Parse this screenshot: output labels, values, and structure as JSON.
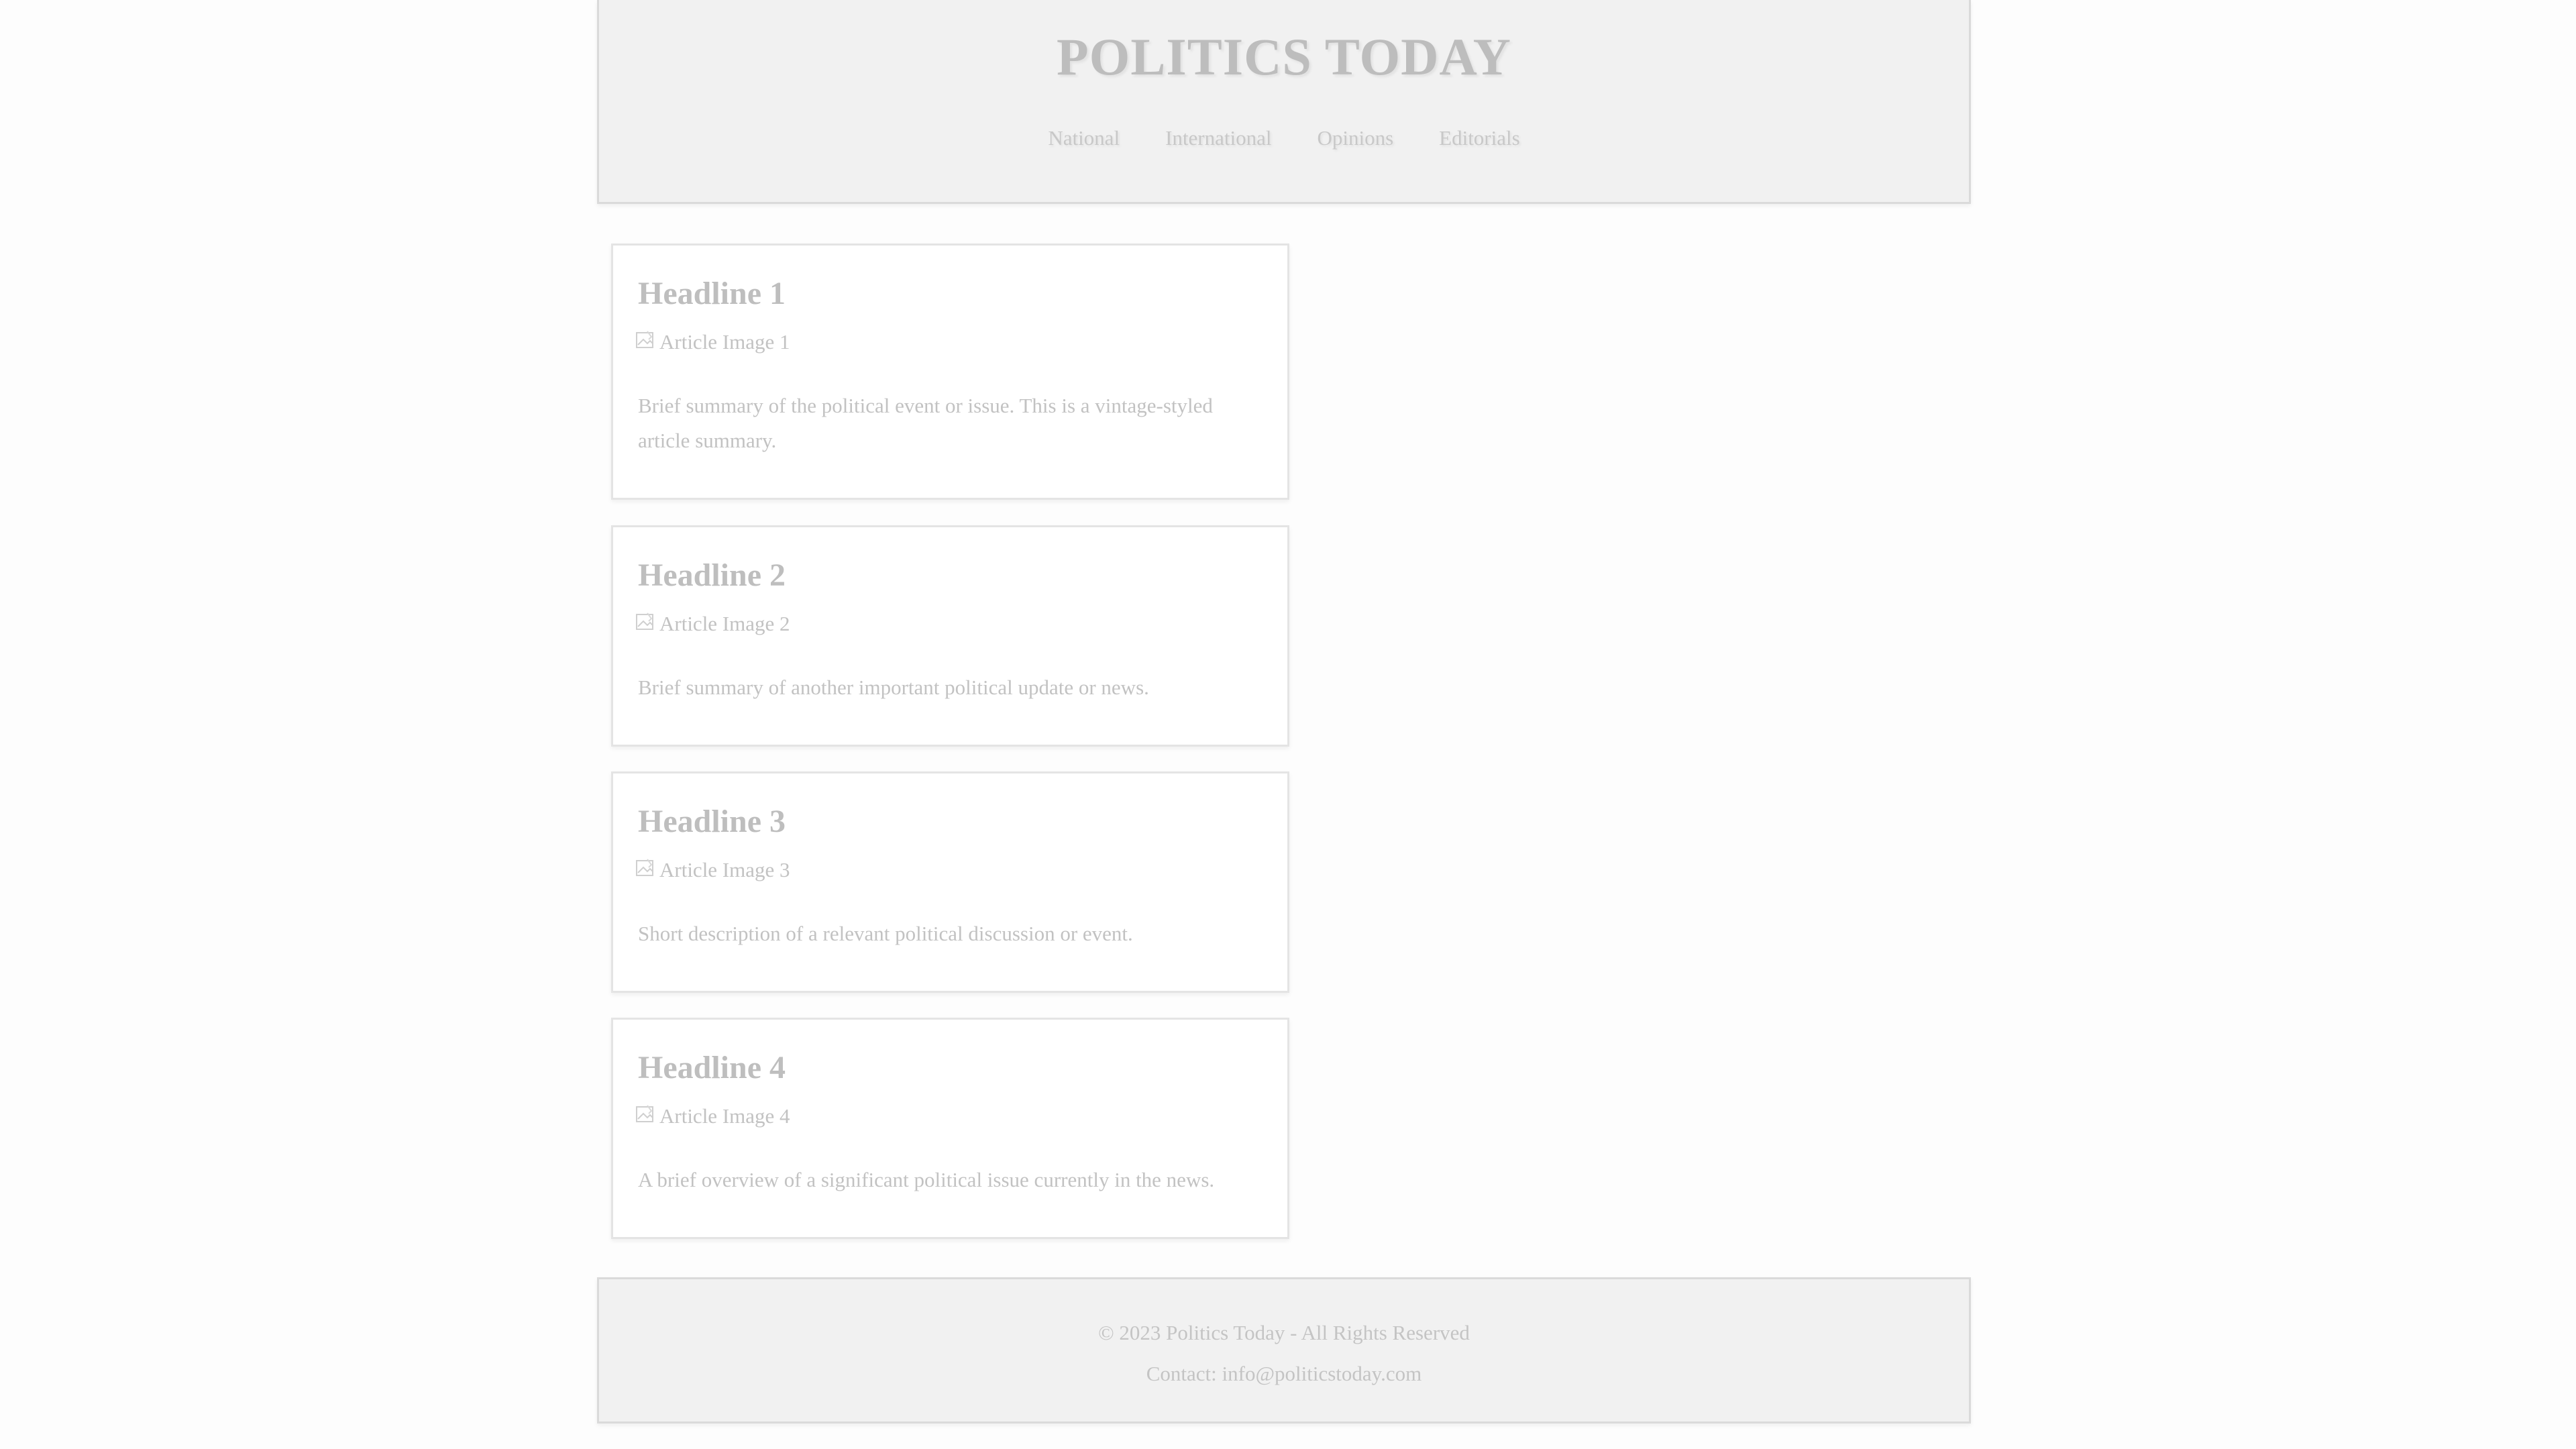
{
  "header": {
    "title": "POLITICS TODAY",
    "nav": [
      {
        "label": "National"
      },
      {
        "label": "International"
      },
      {
        "label": "Opinions"
      },
      {
        "label": "Editorials"
      }
    ]
  },
  "articles": [
    {
      "headline": "Headline 1",
      "image_alt": "Article Image 1",
      "summary": "Brief summary of the political event or issue. This is a vintage-styled article summary."
    },
    {
      "headline": "Headline 2",
      "image_alt": "Article Image 2",
      "summary": "Brief summary of another important political update or news."
    },
    {
      "headline": "Headline 3",
      "image_alt": "Article Image 3",
      "summary": "Short description of a relevant political discussion or event."
    },
    {
      "headline": "Headline 4",
      "image_alt": "Article Image 4",
      "summary": "A brief overview of a significant political issue currently in the news."
    }
  ],
  "footer": {
    "copyright": "© 2023 Politics Today - All Rights Reserved",
    "contact": "Contact: info@politicstoday.com"
  },
  "colors": {
    "background": "#fdfdfd",
    "header_bg": "#f1f1f1",
    "text": "#c2c2c2"
  }
}
